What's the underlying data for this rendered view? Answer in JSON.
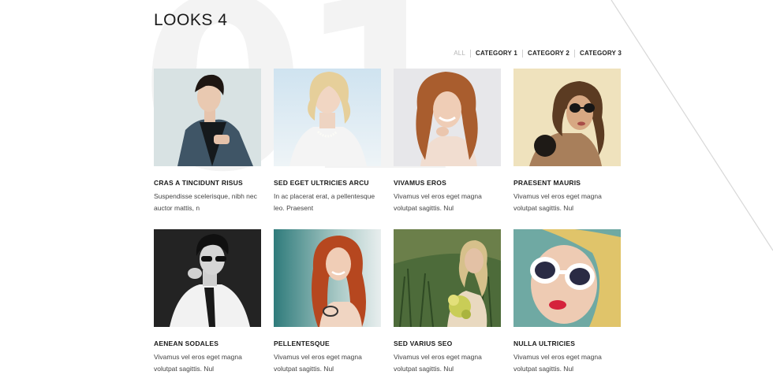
{
  "page": {
    "title": "LOOKS 4",
    "bg_number": "01"
  },
  "filters": [
    {
      "label": "ALL"
    },
    {
      "label": "CATEGORY 1"
    },
    {
      "label": "CATEGORY 2"
    },
    {
      "label": "CATEGORY 3"
    }
  ],
  "items": [
    {
      "title": "CRAS A TINCIDUNT RISUS",
      "desc": "Suspendisse scelerisque, nibh nec auctor mattis, n",
      "image": "man-in-denim-jacket-photo"
    },
    {
      "title": "SED EGET ULTRICIES ARCU",
      "desc": "In ac placerat erat, a pellentesque leo. Praesent",
      "image": "blonde-woman-pearl-necklace-photo"
    },
    {
      "title": "VIVAMUS EROS",
      "desc": "Vivamus vel eros eget magna volutpat sagittis. Nul",
      "image": "smiling-curly-hair-woman-photo"
    },
    {
      "title": "PRAESENT MAURIS",
      "desc": "Vivamus vel eros eget magna volutpat sagittis. Nul",
      "image": "woman-with-sunglasses-photo"
    },
    {
      "title": "AENEAN SODALES",
      "desc": "Vivamus vel eros eget magna volutpat sagittis. Nul",
      "image": "man-in-glasses-bw-photo"
    },
    {
      "title": "PELLENTESQUE",
      "desc": "Vivamus vel eros eget magna volutpat sagittis. Nul",
      "image": "redhead-woman-with-sunglasses-photo"
    },
    {
      "title": "SED VARIUS SEO",
      "desc": "Vivamus vel eros eget magna volutpat sagittis. Nul",
      "image": "woman-in-grass-with-flowers-photo"
    },
    {
      "title": "NULLA ULTRICIES",
      "desc": "Vivamus vel eros eget magna volutpat sagittis. Nul",
      "image": "woman-white-sunglasses-closeup-photo"
    }
  ],
  "colors": {
    "text": "#1a1a1a",
    "muted": "#b5b5b5",
    "body_text": "#444444"
  }
}
